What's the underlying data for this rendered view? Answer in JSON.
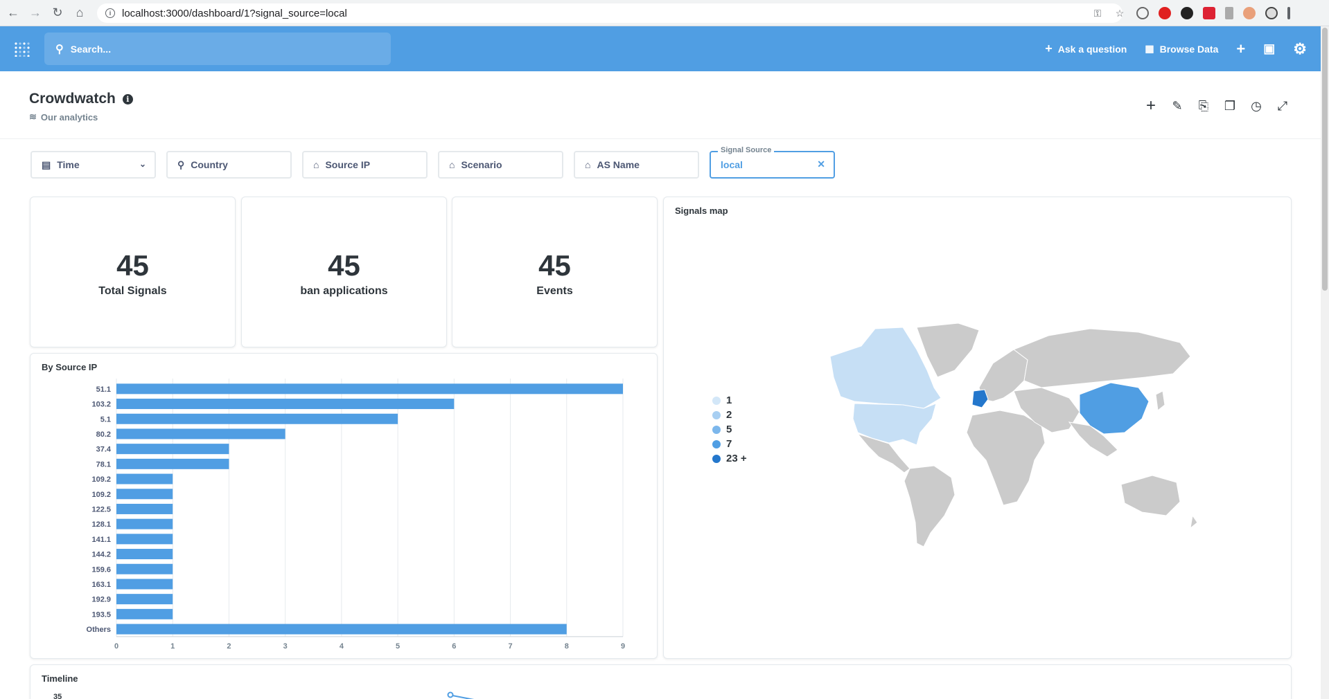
{
  "browser": {
    "url": "localhost:3000/dashboard/1?signal_source=local"
  },
  "nav": {
    "search_placeholder": "Search...",
    "ask_question": "Ask a question",
    "browse_data": "Browse Data"
  },
  "dashboard": {
    "title": "Crowdwatch",
    "collection": "Our analytics"
  },
  "filters": [
    {
      "label": "Time",
      "icon": "calendar-icon"
    },
    {
      "label": "Country",
      "icon": "pin-icon"
    },
    {
      "label": "Source IP",
      "icon": "tag-icon"
    },
    {
      "label": "Scenario",
      "icon": "tag-icon"
    },
    {
      "label": "AS Name",
      "icon": "tag-icon"
    },
    {
      "legend": "Signal Source",
      "value": "local"
    }
  ],
  "cards": {
    "total_signals": {
      "value": "45",
      "label": "Total Signals"
    },
    "ban_applications": {
      "value": "45",
      "label": "ban applications"
    },
    "events": {
      "value": "45",
      "label": "Events"
    }
  },
  "signals_map": {
    "title": "Signals map",
    "legend": [
      {
        "label": "1",
        "color": "#d3e7f8"
      },
      {
        "label": "2",
        "color": "#a8cff2"
      },
      {
        "label": "5",
        "color": "#7cb7ec"
      },
      {
        "label": "7",
        "color": "#509ee3"
      },
      {
        "label": "23 +",
        "color": "#2477cc"
      }
    ]
  },
  "by_source_ip": {
    "title": "By Source IP"
  },
  "timeline": {
    "title": "Timeline",
    "first_tick": "35"
  },
  "chart_data": {
    "type": "bar",
    "orientation": "horizontal",
    "title": "By Source IP",
    "categories": [
      "51.1",
      "103.2",
      "5.1",
      "80.2",
      "37.4",
      "78.1",
      "109.2",
      "109.2",
      "122.5",
      "128.1",
      "141.1",
      "144.2",
      "159.6",
      "163.1",
      "192.9",
      "193.5",
      "Others"
    ],
    "values": [
      9,
      6,
      5,
      3,
      2,
      2,
      1,
      1,
      1,
      1,
      1,
      1,
      1,
      1,
      1,
      1,
      8
    ],
    "xlim": [
      0,
      9
    ],
    "xticks": [
      "0",
      "1",
      "2",
      "3",
      "4",
      "5",
      "6",
      "7",
      "8",
      "9"
    ],
    "color": "#509ee3",
    "grid": true
  }
}
